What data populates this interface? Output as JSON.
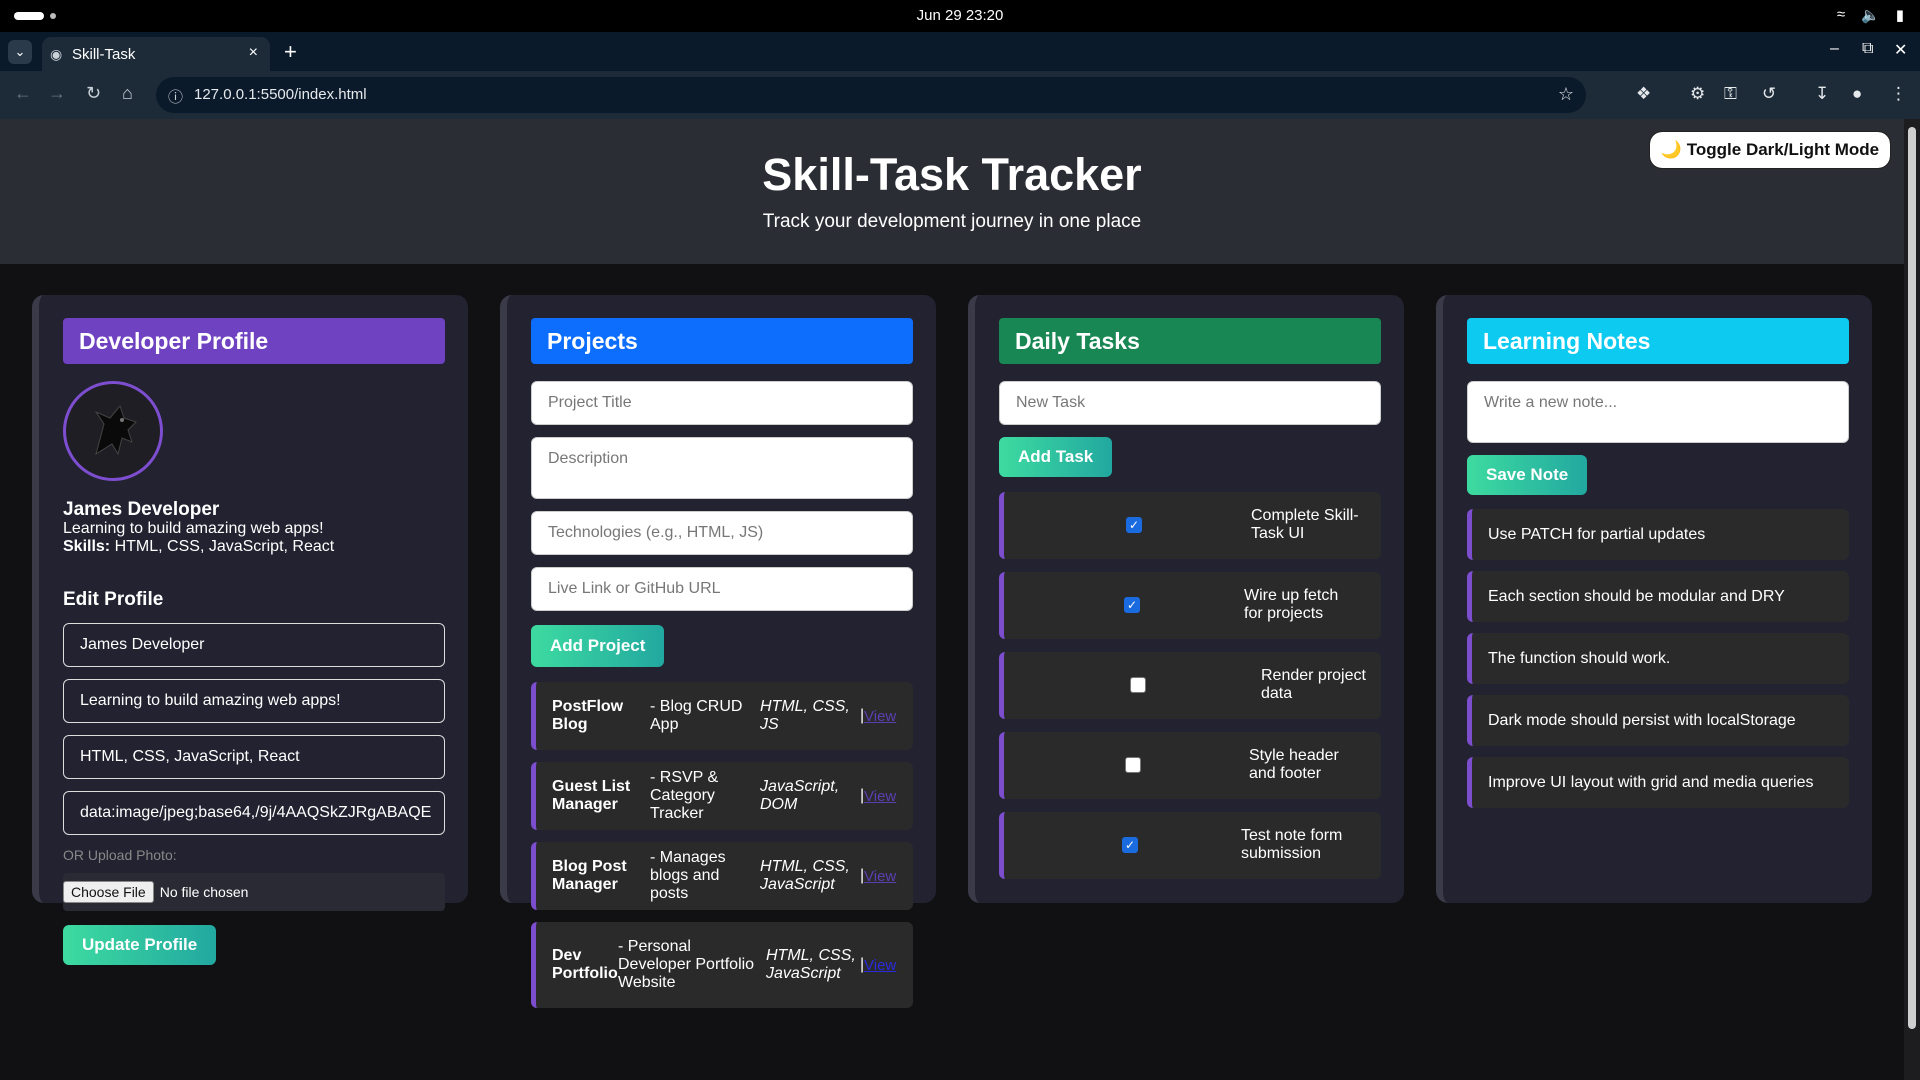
{
  "os": {
    "clock": "Jun 29  23:20"
  },
  "browser": {
    "tab_title": "Skill-Task",
    "url": "127.0.0.1:5500/index.html"
  },
  "header": {
    "title": "Skill-Task Tracker",
    "subtitle": "Track your development journey in one place",
    "toggle_label": "🌙 Toggle Dark/Light Mode"
  },
  "profile": {
    "heading": "Developer Profile",
    "name": "James Developer",
    "bio": "Learning to build amazing web apps!",
    "skills_label": "Skills:",
    "skills": "HTML, CSS, JavaScript, React",
    "edit_heading": "Edit Profile",
    "fields": [
      "James Developer",
      "Learning to build amazing web apps!",
      "HTML, CSS, JavaScript, React",
      "data:image/jpeg;base64,/9j/4AAQSkZJRgABAQE"
    ],
    "upload_label": "OR Upload Photo:",
    "file_button": "Choose File",
    "file_status": "No file chosen",
    "update_button": "Update Profile"
  },
  "projects": {
    "heading": "Projects",
    "placeholders": {
      "title": "Project Title",
      "description": "Description",
      "technologies": "Technologies (e.g., HTML, JS)",
      "link": "Live Link or GitHub URL"
    },
    "add_button": "Add Project",
    "items": [
      {
        "title": "PostFlow Blog",
        "desc": "- Blog CRUD App",
        "tech": "HTML, CSS, JS",
        "sep": "|",
        "link": "View"
      },
      {
        "title": "Guest List Manager",
        "desc": "- RSVP & Category Tracker",
        "tech": "JavaScript, DOM",
        "sep": "|",
        "link": "View"
      },
      {
        "title": "Blog Post Manager",
        "desc": "- Manages blogs and posts",
        "tech": "HTML, CSS, JavaScript",
        "sep": "|",
        "link": "View"
      },
      {
        "title": "Dev Portfolio",
        "desc": "- Personal Developer Portfolio Website",
        "tech": "HTML, CSS, JavaScript",
        "sep": "|",
        "link": "View"
      }
    ]
  },
  "tasks": {
    "heading": "Daily Tasks",
    "placeholder": "New Task",
    "add_button": "Add Task",
    "items": [
      {
        "text": "Complete Skill-Task UI",
        "done": true
      },
      {
        "text": "Wire up fetch for projects",
        "done": true
      },
      {
        "text": "Render project data",
        "done": false
      },
      {
        "text": "Style header and footer",
        "done": false
      },
      {
        "text": "Test note form submission",
        "done": true
      }
    ]
  },
  "notes": {
    "heading": "Learning Notes",
    "placeholder": "Write a new note...",
    "save_button": "Save Note",
    "items": [
      "Use PATCH for partial updates",
      "Each section should be modular and DRY",
      "The function should work.",
      "Dark mode should persist with localStorage",
      "Improve UI layout with grid and media queries"
    ]
  },
  "colors": {
    "profile_head": "#6f42c1",
    "projects_head": "#0d6efd",
    "tasks_head": "#198754",
    "notes_head": "#0dcaf0",
    "accent_border": "#7c4dcc"
  }
}
